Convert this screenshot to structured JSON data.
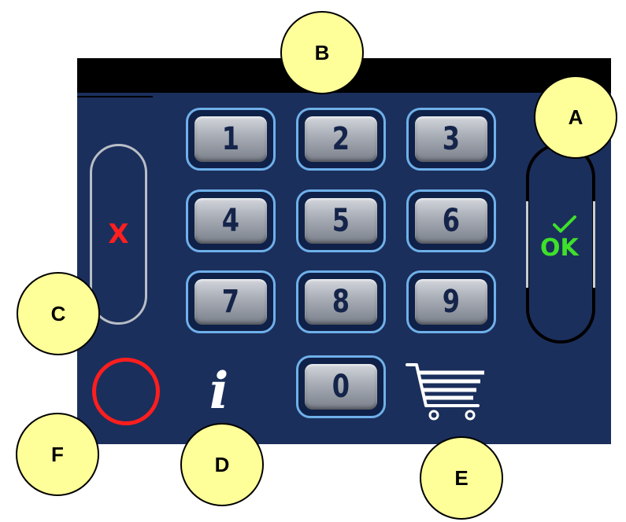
{
  "keypad": {
    "keys": [
      "1",
      "2",
      "3",
      "4",
      "5",
      "6",
      "7",
      "8",
      "9",
      "0"
    ]
  },
  "buttons": {
    "cancel_label": "X",
    "ok_label": "OK"
  },
  "callouts": {
    "a": "A",
    "b": "B",
    "c": "C",
    "d": "D",
    "e": "E",
    "f": "F"
  },
  "icons": {
    "info": "info-icon",
    "cart": "cart-icon",
    "ring": "red-ring-indicator",
    "check": "checkmark-icon"
  },
  "colors": {
    "panel": "#1b2f5c",
    "key_border": "#6fb0ea",
    "cancel_x": "#ff1f1f",
    "ok_text": "#3ee02a",
    "callout_fill": "#ffff99"
  }
}
